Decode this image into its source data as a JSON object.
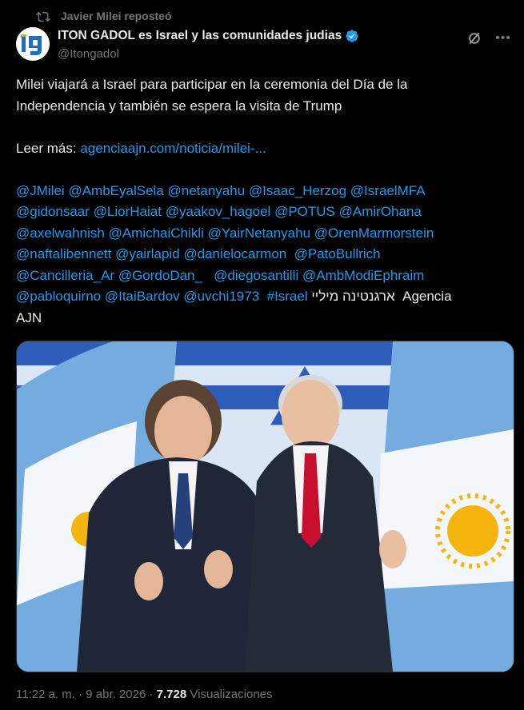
{
  "repost": {
    "label": "Javier Milei reposteó"
  },
  "author": {
    "name": "ITON GADOL es Israel y las comunidades judias",
    "handle": "@Itongadol"
  },
  "post": {
    "line1": "Milei viajará a Israel para participar en la ceremonia del Día de la",
    "line2": "Independencia y también se espera la visita de Trump",
    "read_more_label": "Leer más:",
    "read_more_link": "agenciaajn.com/noticia/milei-...",
    "mentions": [
      [
        "@JMilei",
        "@AmbEyalSela",
        "@netanyahu",
        "@Isaac_Herzog",
        "@IsraelMFA"
      ],
      [
        "@gidonsaar",
        "@LiorHaiat",
        "@yaakov_hagoel",
        "@POTUS",
        "@AmirOhana"
      ],
      [
        "@axelwahnish",
        "@AmichaiChikli",
        "@YairNetanyahu",
        "@OrenMarmorstein"
      ],
      [
        "@naftalibennett",
        "@yairlapid",
        "@danielocarmon",
        "@PatoBullrich"
      ],
      [
        "@Cancilleria_Ar",
        "@GordoDan_",
        "@diegosantilli",
        "@AmbModiEphraim"
      ],
      [
        "@pabloquirno",
        "@ItaiBardov",
        "@uvchi1973",
        "#Israel"
      ]
    ],
    "hebrew": "ארגנטינה מיליי",
    "agency": "Agencia",
    "agency_line2": "AJN"
  },
  "footer": {
    "time": "11:22 a. m. · 9 abr. 2026 ·",
    "views_count": "7.728",
    "views_label": "Visualizaciones"
  },
  "colors": {
    "accent": "#1d9bf0",
    "muted": "#71767b",
    "text": "#e7e9ea"
  }
}
